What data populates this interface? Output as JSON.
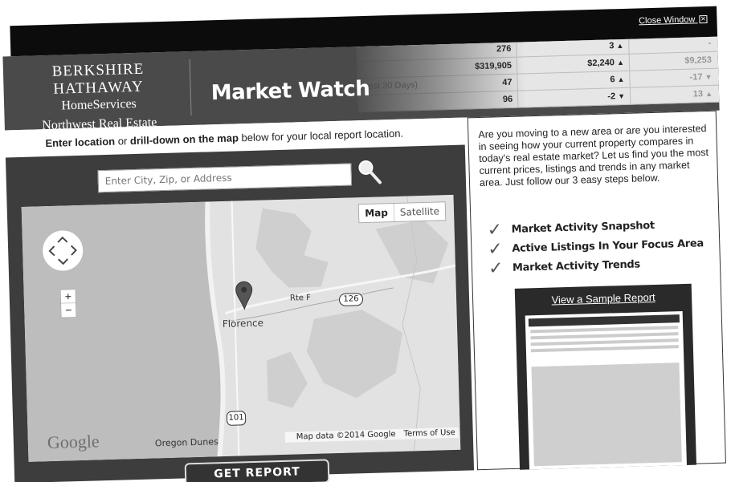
{
  "window": {
    "close_label": "Close Window",
    "close_glyph": "✕"
  },
  "header": {
    "brand": {
      "line1": "BERKSHIRE HATHAWAY",
      "line2": "HomeServices",
      "line3": "Northwest Real Estate"
    },
    "title": "Market Watch"
  },
  "stats": {
    "rows": [
      {
        "label": "",
        "value1": "276",
        "value2": "3",
        "dir2": "▲",
        "value3": "-",
        "dir3": ""
      },
      {
        "label": "",
        "value1": "$319,905",
        "value2": "$2,240",
        "dir2": "▲",
        "value3": "$9,253",
        "dir3": ""
      },
      {
        "label": "(Last 30 Days)",
        "value1": "47",
        "value2": "6",
        "dir2": "▲",
        "value3": "-17",
        "dir3": "▼"
      },
      {
        "label": "",
        "value1": "96",
        "value2": "-2",
        "dir2": "▼",
        "value3": "13",
        "dir3": "▲"
      }
    ]
  },
  "left": {
    "instruction": {
      "bold1": "Enter location",
      "mid": " or ",
      "bold2": "drill-down on the map",
      "rest": " below for your local report location."
    },
    "search": {
      "placeholder": "Enter City, Zip, or Address",
      "icon": "search-icon"
    },
    "map": {
      "toggle_map": "Map",
      "toggle_satellite": "Satellite",
      "zoom_in": "+",
      "zoom_out": "−",
      "city": "Florence",
      "road": "Rte F",
      "shield_126": "126",
      "shield_101": "101",
      "google": "Google",
      "dunes": "Oregon Dunes",
      "map_data": "Map data ©2014 Google",
      "terms": "Terms of Use"
    },
    "get_report": "GET REPORT"
  },
  "right": {
    "intro": "Are you moving to a new area or are you interested in seeing how your current property compares in today's real estate market? Let us find you the most current prices, listings and trends in any market area. Just follow our 3 easy steps below.",
    "steps": [
      {
        "check": "✓",
        "label": "Market Activity Snapshot"
      },
      {
        "check": "✓",
        "label": "Active Listings In Your Focus Area"
      },
      {
        "check": "✓",
        "label": "Market Activity Trends"
      }
    ],
    "sample_link": "View a Sample Report"
  }
}
